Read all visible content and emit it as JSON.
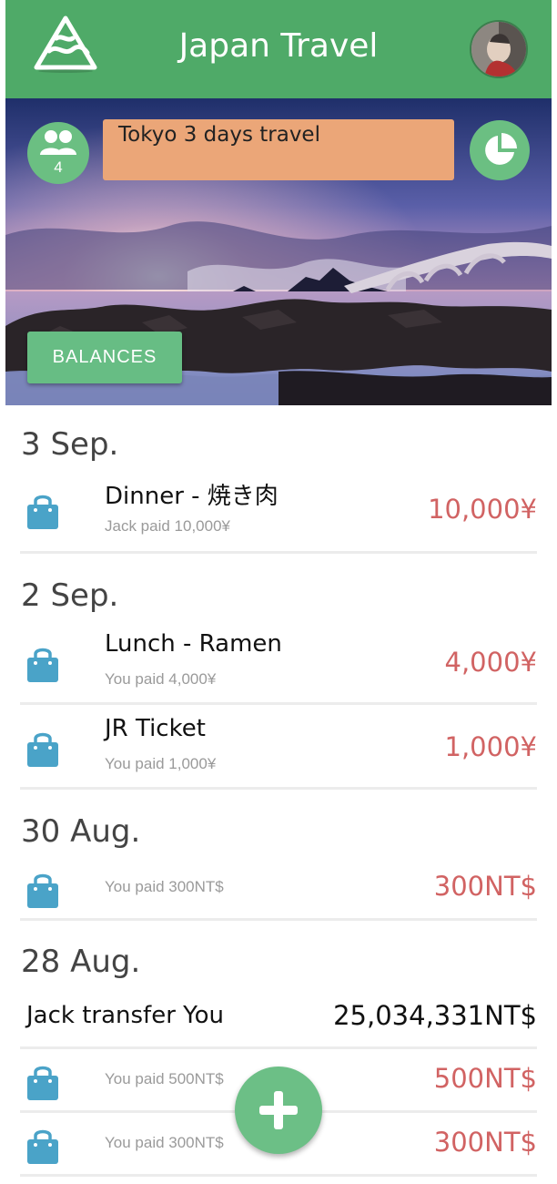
{
  "header": {
    "title": "Japan Travel",
    "logo_icon": "mountain-logo-icon",
    "avatar_icon": "user-avatar"
  },
  "hero": {
    "members_icon": "group-icon",
    "member_count": "4",
    "trip_name": "Tokyo 3 days travel",
    "chart_icon": "pie-chart-icon",
    "balances_label": "BALANCES"
  },
  "expenses": [
    {
      "date": "3 Sep.",
      "items": [
        {
          "title": "Dinner - 焼き肉",
          "sub": "Jack paid 10,000¥",
          "amount": "10,000¥"
        }
      ]
    },
    {
      "date": "2 Sep.",
      "items": [
        {
          "title": "Lunch - Ramen",
          "sub": "You paid 4,000¥",
          "amount": "4,000¥"
        },
        {
          "title": "JR Ticket",
          "sub": "You paid 1,000¥",
          "amount": "1,000¥"
        }
      ]
    },
    {
      "date": "30 Aug.",
      "items": [
        {
          "title": "",
          "sub": "You paid 300NT$",
          "amount": "300NT$"
        }
      ]
    },
    {
      "date": "28 Aug.",
      "transfer": {
        "text": "Jack transfer You",
        "amount": "25,034,331NT$"
      },
      "items": [
        {
          "title": "",
          "sub": "You paid 500NT$",
          "amount": "500NT$"
        },
        {
          "title": "",
          "sub": "You paid 300NT$",
          "amount": "300NT$"
        }
      ]
    }
  ],
  "fab": {
    "icon": "plus-icon"
  },
  "colors": {
    "header": "#4faa68",
    "accent": "#6bbf82",
    "trip_box": "#eba678",
    "amount": "#d16363",
    "bag": "#4aa3c8"
  }
}
